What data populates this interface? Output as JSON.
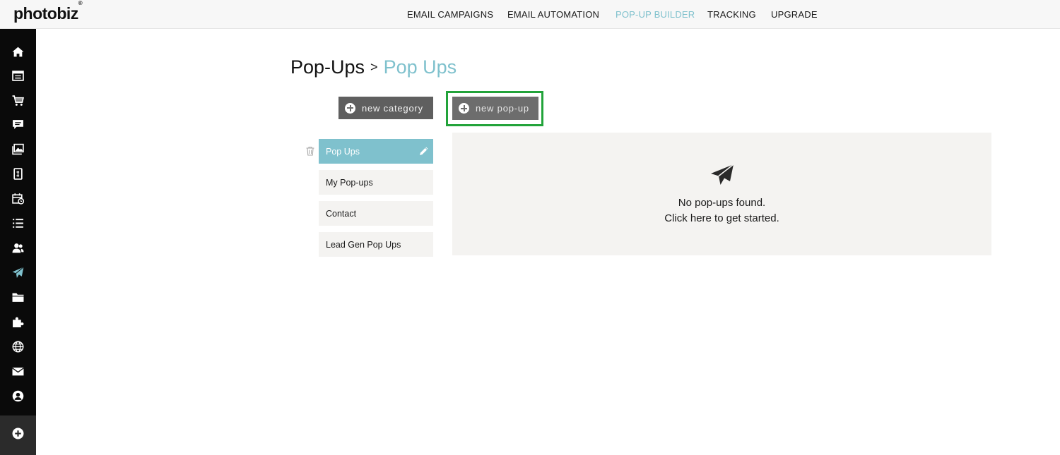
{
  "app": {
    "logo": "photobiz",
    "logo_mark": "®"
  },
  "topnav": [
    {
      "label": "EMAIL CAMPAIGNS",
      "active": false
    },
    {
      "label": "EMAIL AUTOMATION",
      "active": false
    },
    {
      "label": "POP-UP BUILDER",
      "active": true
    },
    {
      "label": "TRACKING",
      "active": false
    },
    {
      "label": "UPGRADE",
      "active": false
    }
  ],
  "sidebar": {
    "icons": [
      "home-icon",
      "calendar-list-icon",
      "cart-icon",
      "chat-icon",
      "gallery-icon",
      "document-icon",
      "calendar-icon",
      "list-icon",
      "users-icon",
      "send-icon",
      "folder-icon",
      "puzzle-icon",
      "globe-icon",
      "mail-icon",
      "account-icon"
    ],
    "active_icon": "send-icon",
    "add_icon": "add-icon",
    "accent": "#7fc1cd"
  },
  "breadcrumb": {
    "root": "Pop-Ups",
    "separator": ">",
    "current": "Pop Ups"
  },
  "toolbar": {
    "new_category_label": "new category",
    "new_popup_label": "new pop-up"
  },
  "categories": [
    {
      "label": "Pop Ups",
      "active": true
    },
    {
      "label": "My Pop-ups",
      "active": false
    },
    {
      "label": "Contact",
      "active": false
    },
    {
      "label": "Lead Gen Pop Ups",
      "active": false
    }
  ],
  "empty_state": {
    "icon": "paper-plane-icon",
    "line1": "No pop-ups found.",
    "line2": "Click here to get started."
  },
  "colors": {
    "accent": "#7fc1cd",
    "highlight": "#22a33a",
    "button": "#6d6d6d"
  }
}
